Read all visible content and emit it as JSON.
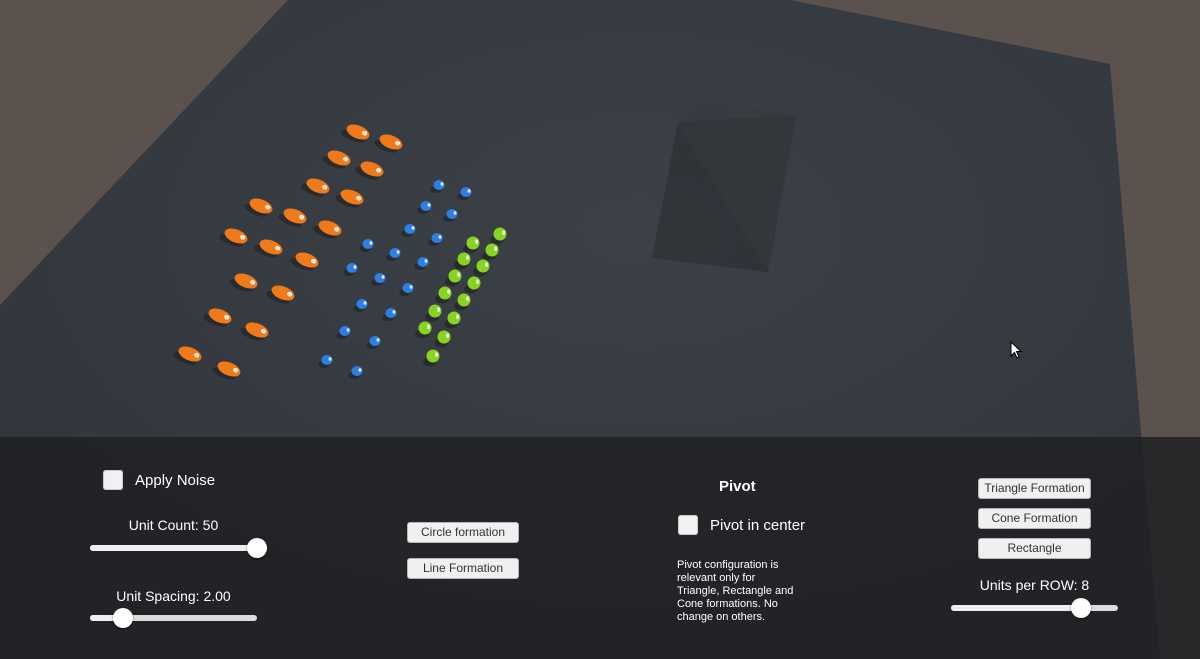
{
  "scene": {
    "background_color": "#5b524d",
    "ground_color": "#363b42",
    "unit_colors": {
      "orange": "#f07a1a",
      "blue": "#2d7fe6",
      "green": "#86d420"
    },
    "cursor_icon": "arrow-cursor-icon"
  },
  "panel": {
    "apply_noise": {
      "label": "Apply Noise",
      "checked": false
    },
    "unit_count": {
      "label": "Unit Count: 50",
      "value": 50,
      "min": 1,
      "max": 50
    },
    "unit_spacing": {
      "label": "Unit Spacing: 2.00",
      "value": 2.0,
      "min": 1.0,
      "max": 6.0
    },
    "circle_formation": {
      "label": "Circle formation"
    },
    "line_formation": {
      "label": "Line Formation"
    },
    "pivot": {
      "heading": "Pivot",
      "center_label": "Pivot in center",
      "checked": false,
      "note": "Pivot configuration is\nrelevant only for\nTriangle, Rectangle and\nCone formations. No\nchange on others."
    },
    "triangle_formation": {
      "label": "Triangle Formation"
    },
    "cone_formation": {
      "label": "Cone Formation"
    },
    "rectangle": {
      "label": "Rectangle"
    },
    "units_per_row": {
      "label": "Units per ROW: 8",
      "value": 8,
      "min": 1,
      "max": 10
    }
  }
}
